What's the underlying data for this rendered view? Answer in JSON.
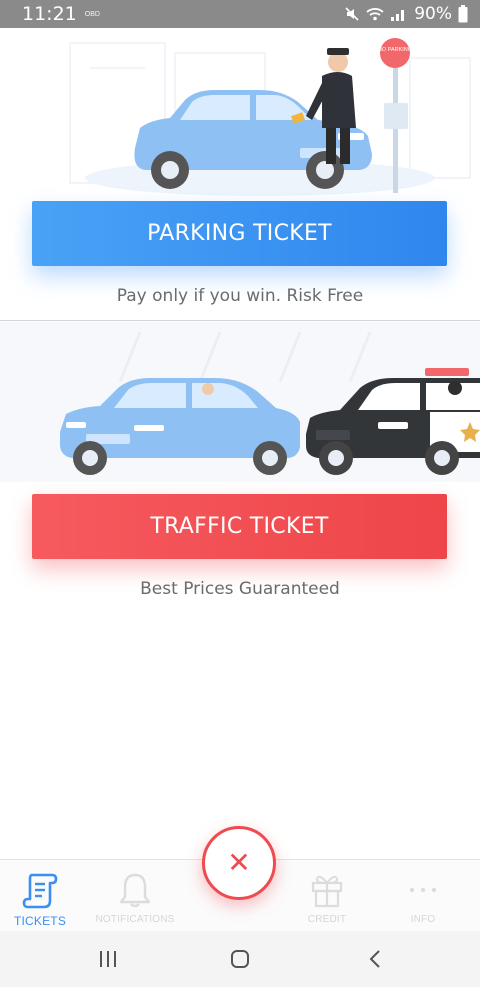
{
  "status_bar": {
    "time": "11:21",
    "carrier_tag": "OBD",
    "battery": "90%"
  },
  "parking": {
    "button_label": "PARKING TICKET",
    "tagline": "Pay only if you win. Risk Free",
    "sign_text": "NO PARKING"
  },
  "traffic": {
    "button_label": "TRAFFIC TICKET",
    "tagline": "Best Prices Guaranteed"
  },
  "bottom_nav": {
    "items": [
      {
        "label": "TICKETS",
        "icon": "ticket-scroll-icon",
        "active": true
      },
      {
        "label": "NOTIFICATIONS",
        "icon": "bell-icon",
        "active": false
      },
      {
        "label": "CREDIT",
        "icon": "gift-icon",
        "active": false
      },
      {
        "label": "INFO",
        "icon": "more-dots-icon",
        "active": false
      }
    ],
    "fab_icon": "close-icon",
    "fab_glyph": "✕"
  },
  "system_nav": {
    "icons": [
      "recent-apps-icon",
      "home-icon",
      "back-icon"
    ]
  },
  "colors": {
    "parking_blue": "#3b8ff0",
    "traffic_red": "#ef4a4f",
    "tagline_grey": "#6b6b6b"
  }
}
